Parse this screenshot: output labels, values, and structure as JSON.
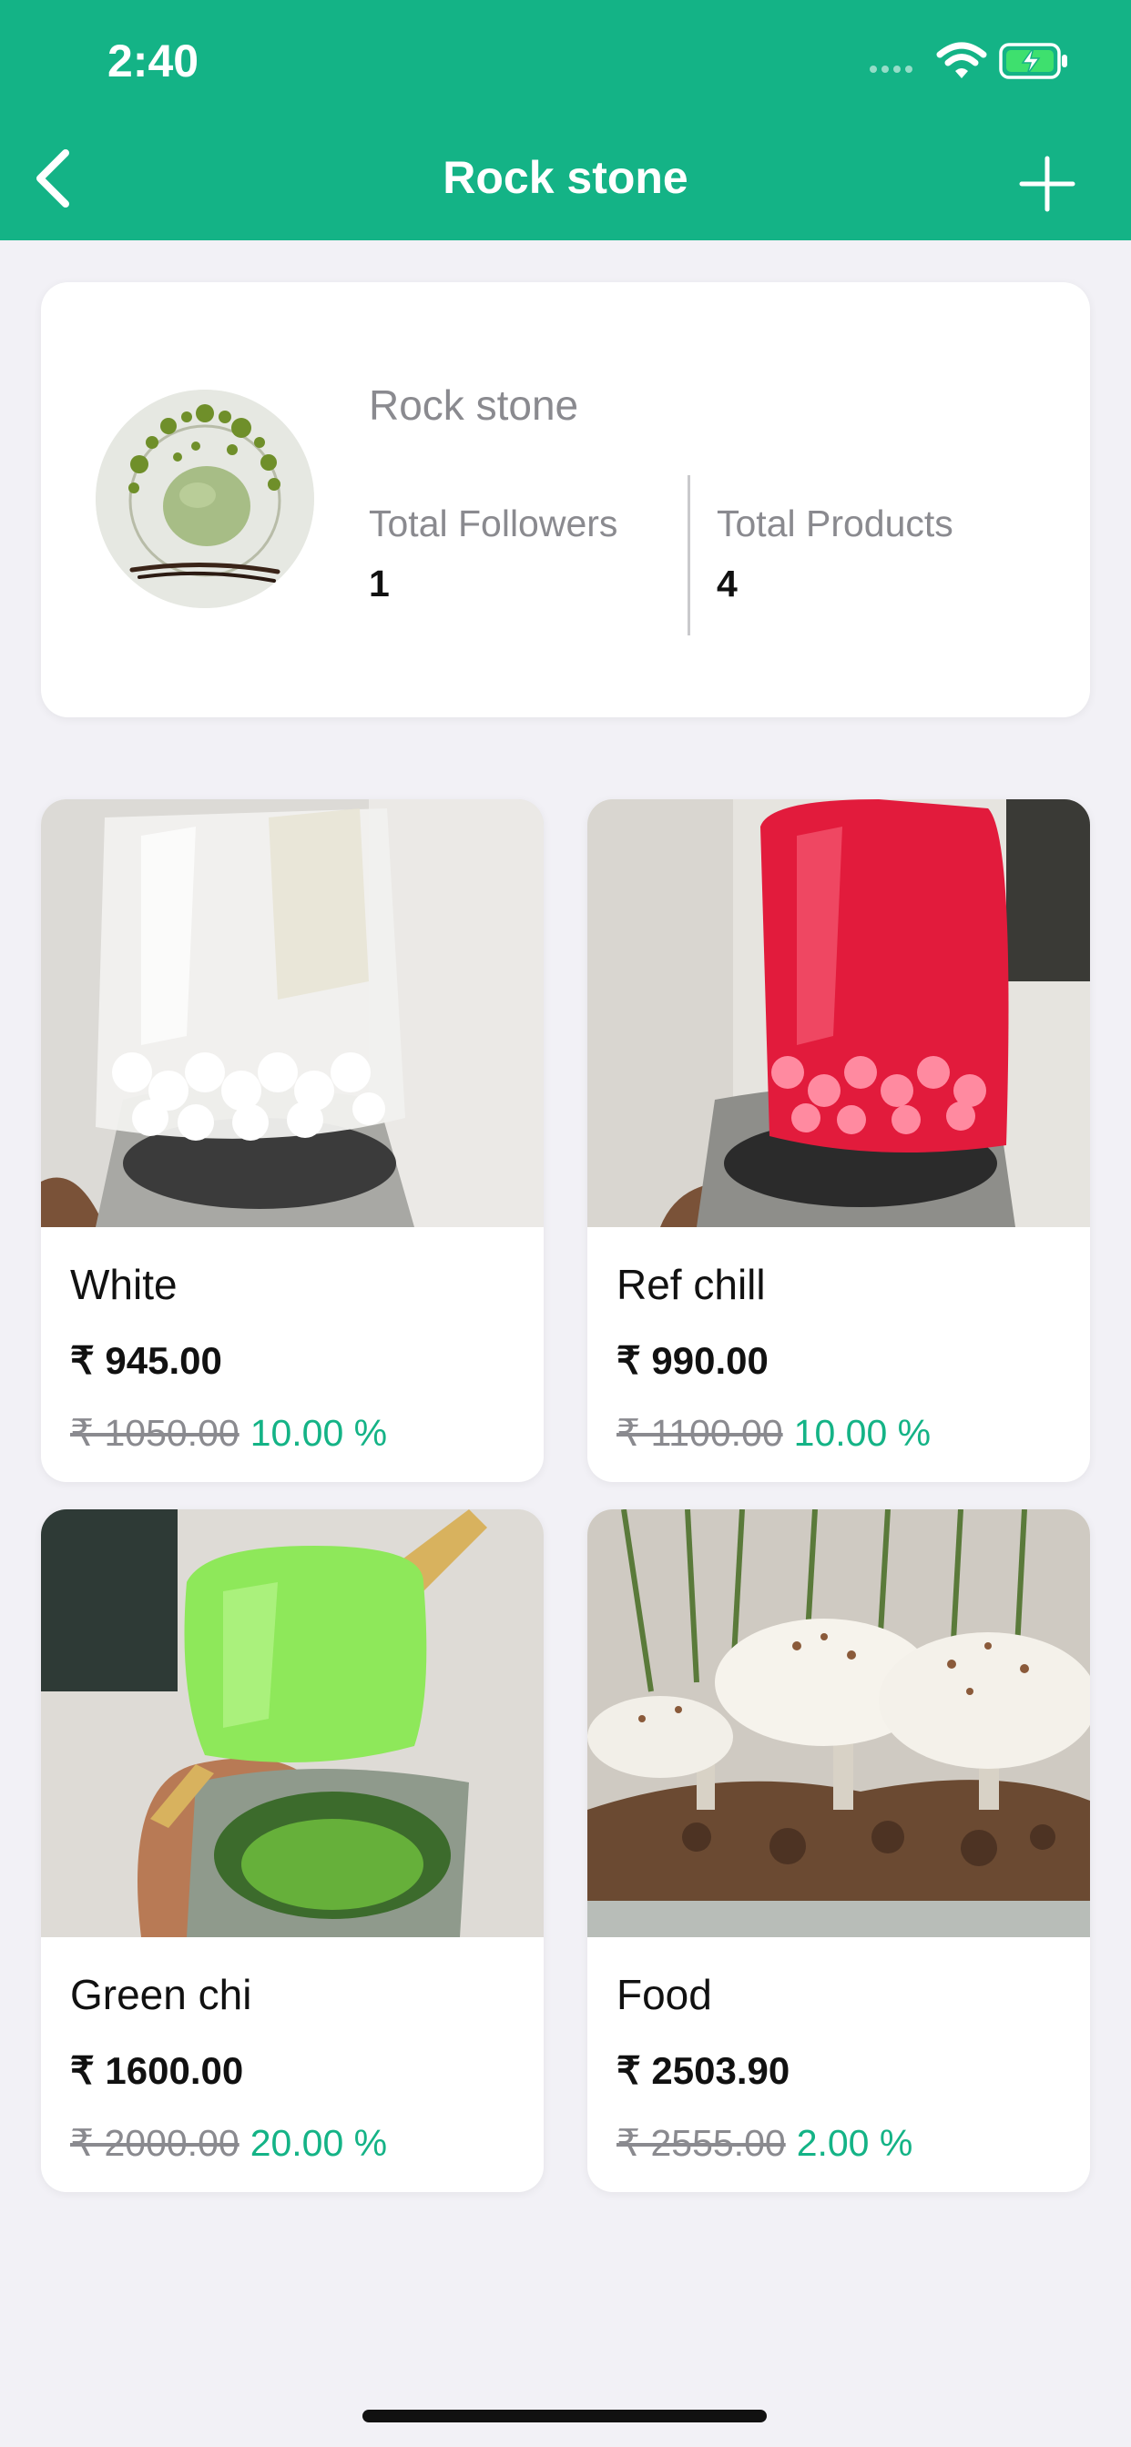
{
  "status_bar": {
    "time": "2:40"
  },
  "nav": {
    "title": "Rock stone"
  },
  "profile": {
    "name": "Rock stone",
    "followers_label": "Total Followers",
    "followers_value": "1",
    "products_label": "Total Products",
    "products_value": "4"
  },
  "products": [
    {
      "name": "White",
      "price": "₹ 945.00",
      "old_price": "₹ 1050.00",
      "discount": "10.00 %"
    },
    {
      "name": "Ref chill",
      "price": "₹ 990.00",
      "old_price": "₹ 1100.00",
      "discount": "10.00 %"
    },
    {
      "name": "Green chi",
      "price": "₹ 1600.00",
      "old_price": "₹ 2000.00",
      "discount": "20.00 %"
    },
    {
      "name": "Food",
      "price": "₹ 2503.90",
      "old_price": "₹ 2555.00",
      "discount": "2.00 %"
    }
  ],
  "colors": {
    "accent": "#14b386",
    "background": "#f2f1f6"
  }
}
